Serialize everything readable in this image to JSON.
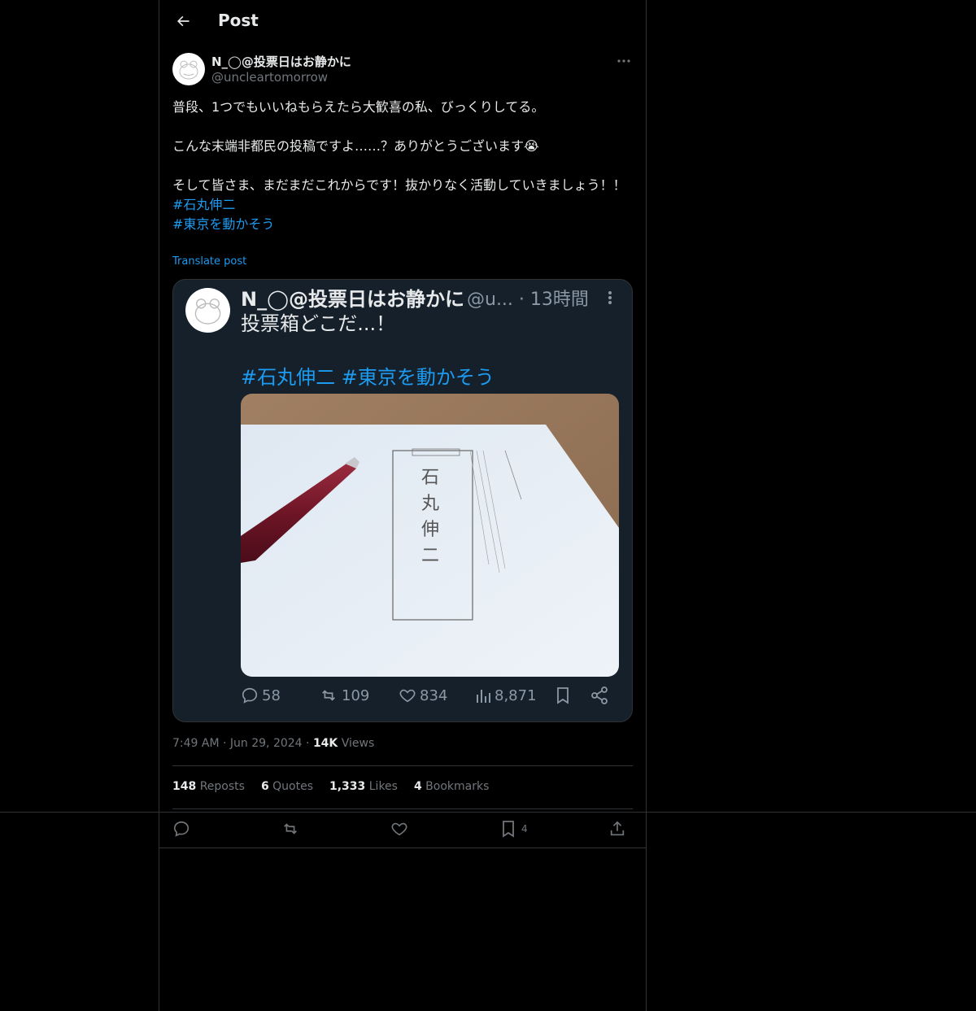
{
  "header": {
    "title": "Post"
  },
  "author": {
    "display_name": "N_◯@投票日はお静かに",
    "handle": "@uncleartomorrow"
  },
  "post": {
    "lines": [
      "普段、1つでもいいねもらえたら大歓喜の私、びっくりしてる。",
      "",
      "こんな末端非都民の投稿ですよ……？ありがとうございます😭",
      "",
      "そして皆さま、まだまだこれからです！抜かりなく活動していきましょう！！"
    ],
    "hashtags": [
      "#石丸伸二",
      "#東京を動かそう"
    ],
    "translate_label": "Translate post"
  },
  "embedded_screenshot": {
    "name": "N_◯@投票日はお静かに",
    "handle_time": "@u... · 13時間",
    "text": "投票箱どこだ...！",
    "hashtags": "#石丸伸二 #東京を動かそう",
    "ballot_text": "石丸伸二",
    "replies": "58",
    "reposts": "109",
    "likes": "834",
    "views": "8,871"
  },
  "meta": {
    "time": "7:49 AM",
    "date": "Jun 29, 2024",
    "views_count": "14K",
    "views_label": "Views"
  },
  "stats": {
    "reposts_count": "148",
    "reposts_label": "Reposts",
    "quotes_count": "6",
    "quotes_label": "Quotes",
    "likes_count": "1,333",
    "likes_label": "Likes",
    "bookmarks_count": "4",
    "bookmarks_label": "Bookmarks"
  },
  "actions": {
    "bookmark_count": "4"
  },
  "colors": {
    "accent": "#1d9bf0",
    "background": "#000000",
    "border": "#2f3336",
    "muted": "#71767b"
  }
}
